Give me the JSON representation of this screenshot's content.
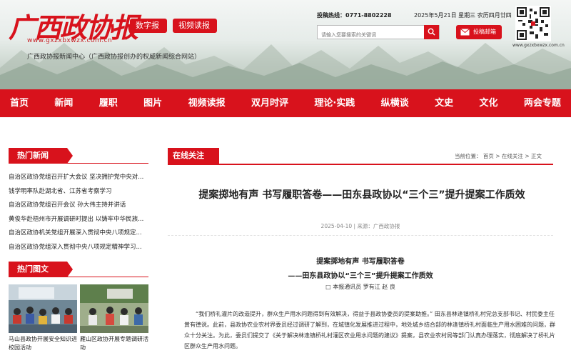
{
  "header": {
    "logo_text": "广西政协报",
    "logo_url": "www.gxzxbxwzx.com.cn",
    "tagline": "广西政协报新闻中心（广西政协报创办的权威新闻综合网站）",
    "digital_paper_label": "数字报",
    "video_paper_label": "视频读报",
    "hotline_label": "投稿热线：",
    "hotline_number": "0771-8802228",
    "date_text": "2025年5月21日 星期三 农历四月廿四",
    "search_placeholder": "请输入您要搜索的关键词",
    "mail_label": "投稿邮箱",
    "qr_caption": "www.gxzxbxwzx.com.cn"
  },
  "nav": {
    "items": [
      "首页",
      "新闻",
      "履职",
      "图片",
      "视频读报",
      "双月时评",
      "理论·实践",
      "纵横谈",
      "文史",
      "文化",
      "两会专题"
    ]
  },
  "sidebar": {
    "hot_news_title": "热门新闻",
    "hot_news": [
      "自治区政协党组召开扩大会议 坚决拥护党中央对...",
      "钱学明率队赴湖北省、江苏省考察学习",
      "自治区政协党组召开会议 孙大伟主持并讲话",
      "黄俊华赴梧州市开展调研时提出 以铸牢中华民族...",
      "自治区政协机关党组开展深入贯彻中央八项规定...",
      "自治区政协党组深入贯彻中央八项规定精神学习..."
    ],
    "hot_photos_title": "热门图文",
    "photos": [
      {
        "caption": "马山县政协开展安全知识进校园活动"
      },
      {
        "caption": "雁山区政协开展专题调研活动"
      }
    ]
  },
  "main": {
    "section_title": "在线关注",
    "breadcrumb_label": "当前位置：",
    "breadcrumb": [
      "首页",
      "在线关注",
      "正文"
    ],
    "breadcrumb_sep": ">",
    "title": "提案掷地有声 书写履职答卷——田东县政协以“三个三”提升提案工作质效",
    "meta": "2025-04-10 | 来源：广西政协报",
    "subtitle1": "提案掷地有声 书写履职答卷",
    "subtitle2": "——田东县政协以“三个三”提升提案工作质效",
    "byline": "□ 本报通讯员 罗有江 赵 良",
    "paragraph": "“我们桥礼灌片的改造提升，群众生产用水问题得到有效解决，得益于县政协委员的提案助推。” 田东县林逢镇桥礼村党总支部书记、村民委主任黄有德说。此前，县政协农业农村界委员经过调研了解到，在城镇化发展推进过程中，地处城乡结合部的林逢镇桥礼村面临生产用水困难的问题，群众十分关注。为此，委员们提交了《关于解决林逢镇桥礼村灌区农业用水问题的建议》提案，县农业农村局等部门认真办理落实，彻底解决了桥礼片区群众生产用水问题。"
  },
  "colors": {
    "brand_red": "#d8121c"
  }
}
